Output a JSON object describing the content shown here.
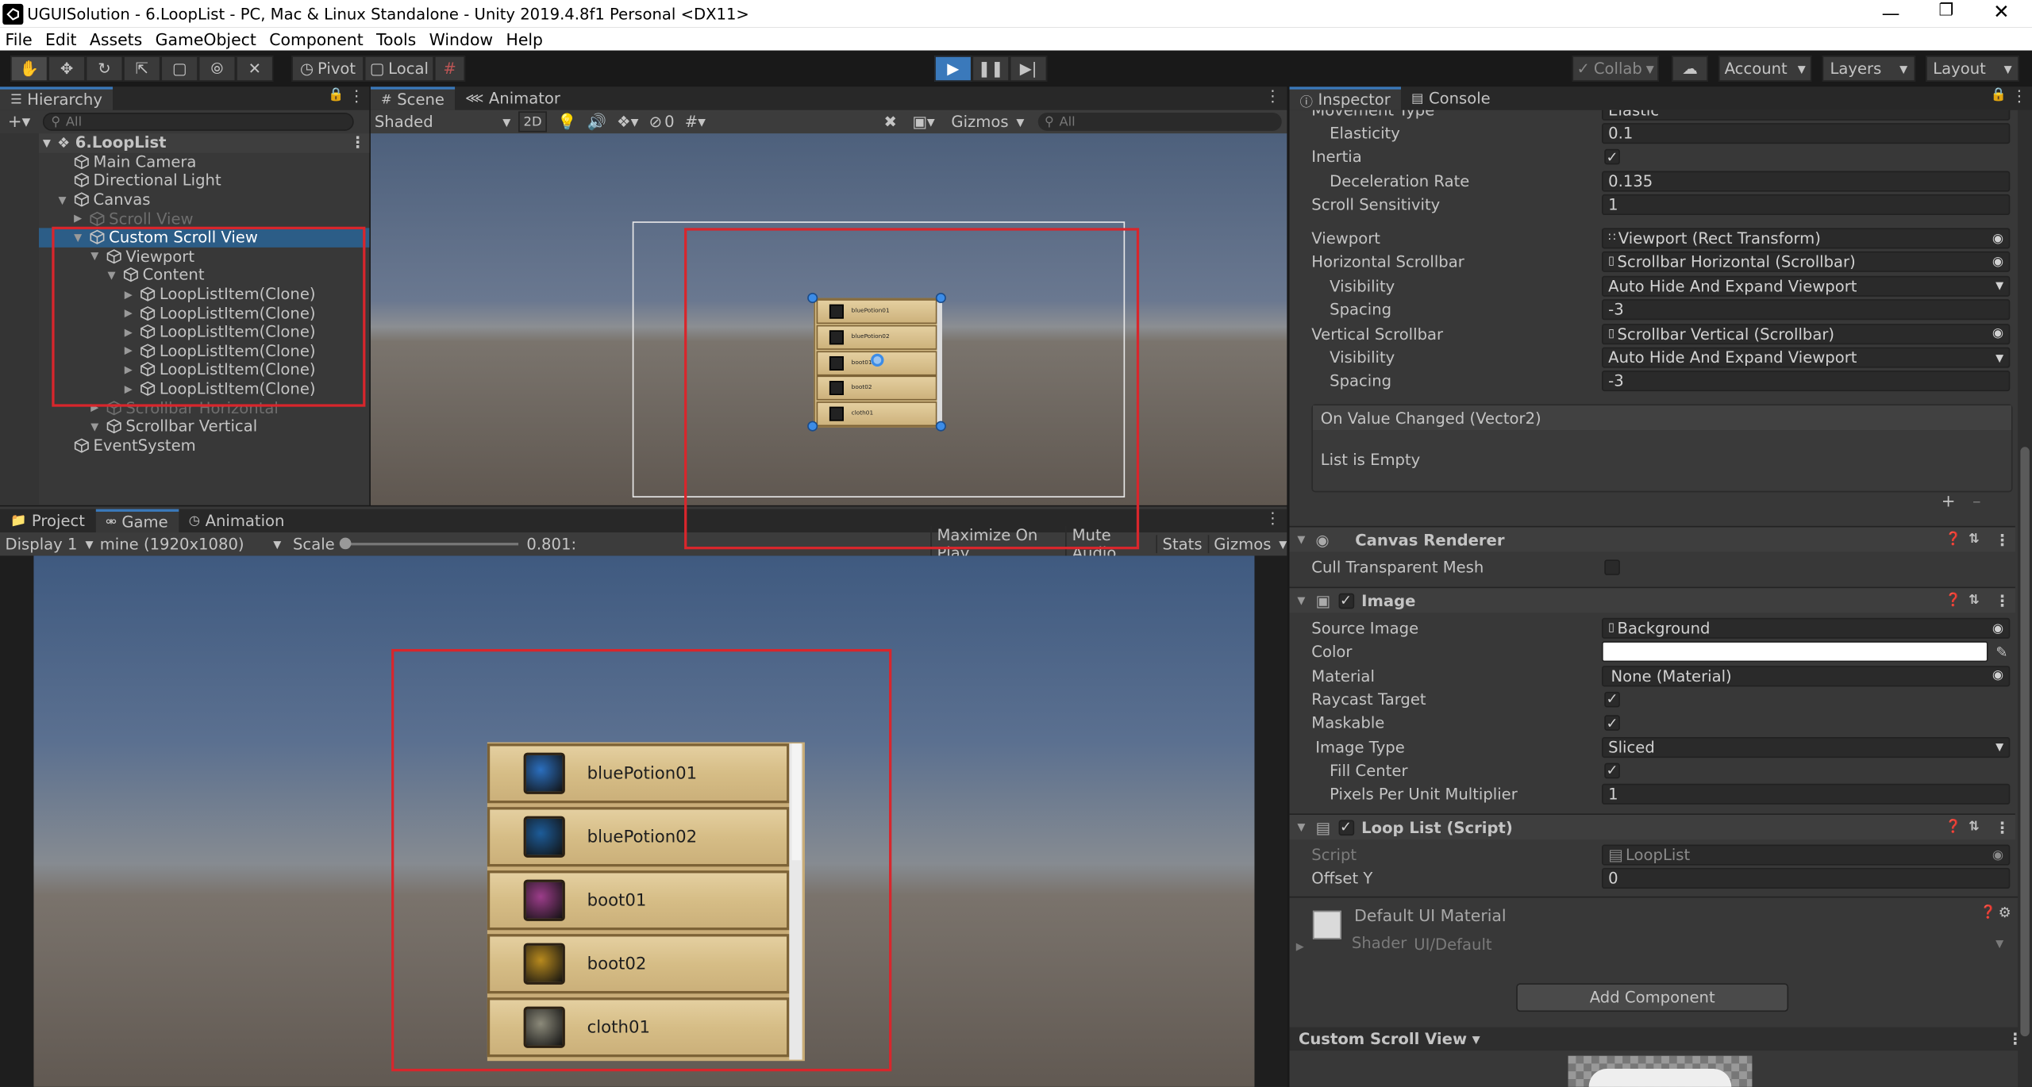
{
  "window": {
    "title": "UGUISolution - 6.LoopList - PC, Mac & Linux Standalone - Unity 2019.4.8f1 Personal <DX11>"
  },
  "menu": [
    "File",
    "Edit",
    "Assets",
    "GameObject",
    "Component",
    "Tools",
    "Window",
    "Help"
  ],
  "toolbar": {
    "pivot": "Pivot",
    "local": "Local",
    "collab": "Collab",
    "account": "Account",
    "layers": "Layers",
    "layout": "Layout"
  },
  "hierarchy": {
    "tab": "Hierarchy",
    "search_placeholder": "All",
    "scene": "6.LoopList",
    "items": [
      {
        "label": "Main Camera",
        "indent": 0,
        "arrow": false,
        "dim": false
      },
      {
        "label": "Directional Light",
        "indent": 0,
        "arrow": false,
        "dim": false
      },
      {
        "label": "Canvas",
        "indent": 0,
        "arrow": true,
        "dim": false
      },
      {
        "label": "Scroll View",
        "indent": 1,
        "arrow": true,
        "dim": true
      },
      {
        "label": "Custom Scroll View",
        "indent": 1,
        "arrow": true,
        "dim": false,
        "selected": true
      },
      {
        "label": "Viewport",
        "indent": 2,
        "arrow": true,
        "dim": false
      },
      {
        "label": "Content",
        "indent": 3,
        "arrow": true,
        "dim": false
      },
      {
        "label": "LoopListItem(Clone)",
        "indent": 4,
        "arrow": true,
        "dim": false
      },
      {
        "label": "LoopListItem(Clone)",
        "indent": 4,
        "arrow": true,
        "dim": false
      },
      {
        "label": "LoopListItem(Clone)",
        "indent": 4,
        "arrow": true,
        "dim": false
      },
      {
        "label": "LoopListItem(Clone)",
        "indent": 4,
        "arrow": true,
        "dim": false
      },
      {
        "label": "LoopListItem(Clone)",
        "indent": 4,
        "arrow": true,
        "dim": false
      },
      {
        "label": "LoopListItem(Clone)",
        "indent": 4,
        "arrow": true,
        "dim": false
      },
      {
        "label": "Scrollbar Horizontal",
        "indent": 2,
        "arrow": true,
        "dim": true
      },
      {
        "label": "Scrollbar Vertical",
        "indent": 2,
        "arrow": true,
        "dim": false
      },
      {
        "label": "EventSystem",
        "indent": 0,
        "arrow": false,
        "dim": false
      }
    ]
  },
  "scene": {
    "tab": "Scene",
    "tab2": "Animator",
    "shading": "Shaded",
    "mode2d": "2D",
    "hidden_count": "0",
    "gizmos": "Gizmos",
    "search_placeholder": "All"
  },
  "game": {
    "tab_project": "Project",
    "tab_game": "Game",
    "tab_animation": "Animation",
    "display": "Display 1",
    "resolution": "mine (1920x1080)",
    "scale_label": "Scale",
    "scale_value": "0.801:",
    "maximize": "Maximize On Play",
    "mute": "Mute Audio",
    "stats": "Stats",
    "gizmos": "Gizmos",
    "items": [
      "bluePotion01",
      "bluePotion02",
      "boot01",
      "boot02",
      "cloth01"
    ]
  },
  "inspector": {
    "tab": "Inspector",
    "tab2": "Console",
    "cut_label": "Movement Type",
    "cut_value": "Elastic",
    "rows1": [
      {
        "label": "Elasticity",
        "value": "0.1",
        "indent": 1
      },
      {
        "label": "Inertia",
        "check": true,
        "indent": 0
      },
      {
        "label": "Deceleration Rate",
        "value": "0.135",
        "indent": 1
      },
      {
        "label": "Scroll Sensitivity",
        "value": "1",
        "indent": 0
      }
    ],
    "rows2": [
      {
        "label": "Viewport",
        "value": "Viewport (Rect Transform)",
        "indent": 0
      },
      {
        "label": "Horizontal Scrollbar",
        "value": "Scrollbar Horizontal (Scrollbar)",
        "indent": 0
      },
      {
        "label": "Visibility",
        "value": "Auto Hide And Expand Viewport",
        "indent": 1
      },
      {
        "label": "Spacing",
        "value": "-3",
        "indent": 1
      },
      {
        "label": "Vertical Scrollbar",
        "value": "Scrollbar Vertical (Scrollbar)",
        "indent": 0
      },
      {
        "label": "Visibility",
        "value": "Auto Hide And Expand Viewport",
        "indent": 1
      },
      {
        "label": "Spacing",
        "value": "-3",
        "indent": 1
      }
    ],
    "event": {
      "title": "On Value Changed (Vector2)",
      "empty": "List is Empty"
    },
    "canvas_renderer": {
      "title": "Canvas Renderer",
      "cull": "Cull Transparent Mesh"
    },
    "image": {
      "title": "Image",
      "rows": [
        {
          "label": "Source Image",
          "value": "Background"
        },
        {
          "label": "Color",
          "value": ""
        },
        {
          "label": "Material",
          "value": "None (Material)"
        },
        {
          "label": "Raycast Target",
          "check": true
        },
        {
          "label": "Maskable",
          "check": true
        },
        {
          "label": "Image Type",
          "value": "Sliced"
        },
        {
          "label": "Fill Center",
          "check": true
        },
        {
          "label": "Pixels Per Unit Multiplier",
          "value": "1"
        }
      ]
    },
    "looplist": {
      "title": "Loop List (Script)",
      "script_label": "Script",
      "script_value": "LoopList",
      "offset_label": "Offset Y",
      "offset_value": "0"
    },
    "material": {
      "title": "Default UI Material",
      "shader_label": "Shader",
      "shader_value": "UI/Default"
    },
    "add_component": "Add Component",
    "preview_label": "Custom Scroll View"
  },
  "colors": {
    "accent": "#3a79bb",
    "selection": "#2c5d87",
    "panel": "#383838",
    "highlight_red": "#d8262c"
  }
}
